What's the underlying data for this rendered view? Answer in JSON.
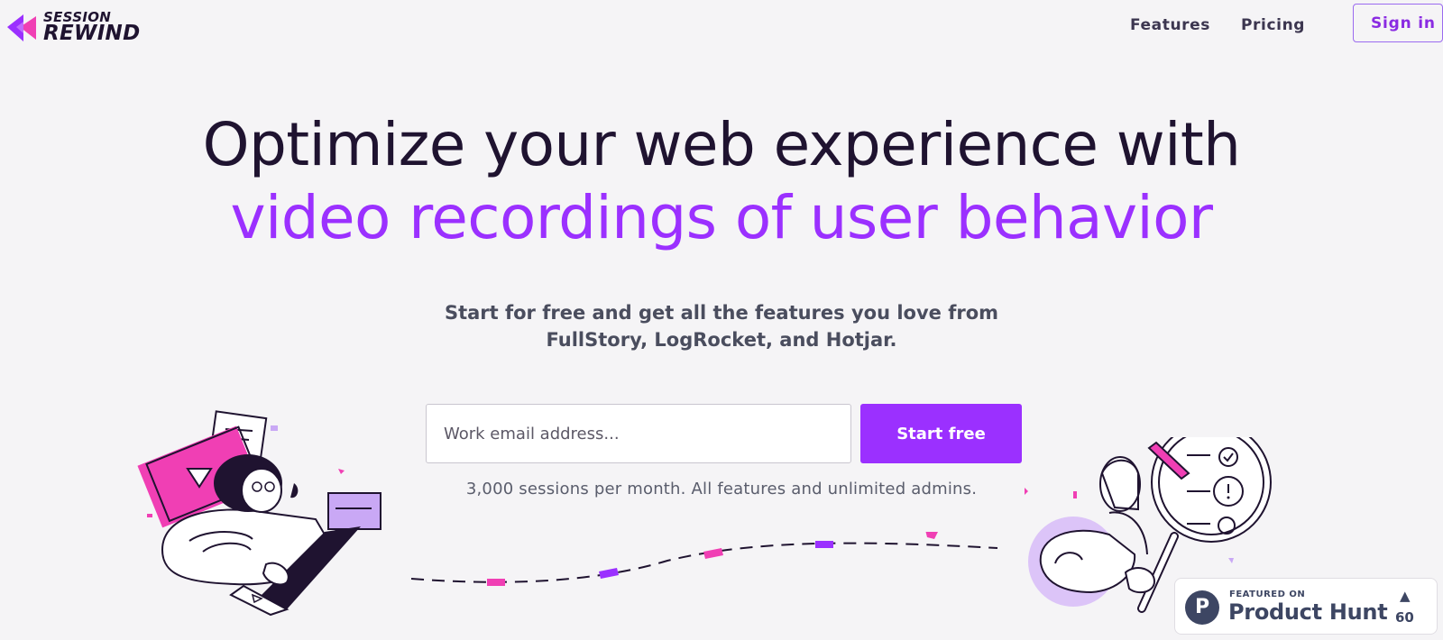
{
  "header": {
    "logo_top": "SESSION",
    "logo_bottom": "REWIND",
    "nav": [
      "Features",
      "Pricing"
    ],
    "signin_label": "Sign in"
  },
  "hero": {
    "headline_line1": "Optimize your web experience with",
    "headline_line2": "video recordings of user behavior",
    "subheading_line1": "Start for free and get all the features you love from",
    "subheading_line2": "FullStory, LogRocket, and Hotjar.",
    "email_placeholder": "Work email address...",
    "cta_label": "Start free",
    "note": "3,000 sessions per month. All features and unlimited admins."
  },
  "product_hunt": {
    "small": "FEATURED ON",
    "name": "Product Hunt",
    "arrow": "▲",
    "count": "60"
  },
  "colors": {
    "accent": "#9b30ff",
    "pink": "#f03fb4",
    "background": "#f5f4f6",
    "text": "#1f1330"
  }
}
